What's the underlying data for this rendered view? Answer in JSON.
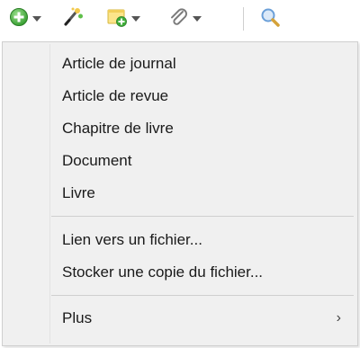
{
  "toolbar": {
    "buttons": [
      {
        "icon": "add-item-icon",
        "has_dropdown": true
      },
      {
        "icon": "magic-wand-icon",
        "has_dropdown": false
      },
      {
        "icon": "add-note-icon",
        "has_dropdown": true
      },
      {
        "icon": "attachment-icon",
        "has_dropdown": true
      },
      {
        "icon": "search-icon",
        "has_dropdown": false
      }
    ]
  },
  "menu": {
    "items": [
      {
        "label": "Article de journal"
      },
      {
        "label": "Article de revue"
      },
      {
        "label": "Chapitre de livre"
      },
      {
        "label": "Document"
      },
      {
        "label": "Livre"
      },
      {
        "label": "Lien vers un fichier..."
      },
      {
        "label": "Stocker une copie du fichier..."
      },
      {
        "label": "Plus",
        "submenu_arrow": "›"
      }
    ]
  },
  "colors": {
    "menu_background": "#f0f0f0",
    "separator": "#cfcfcf",
    "text": "#1a1a1a",
    "add_green": "#3fae3a",
    "search_blue": "#6a9fd8"
  }
}
